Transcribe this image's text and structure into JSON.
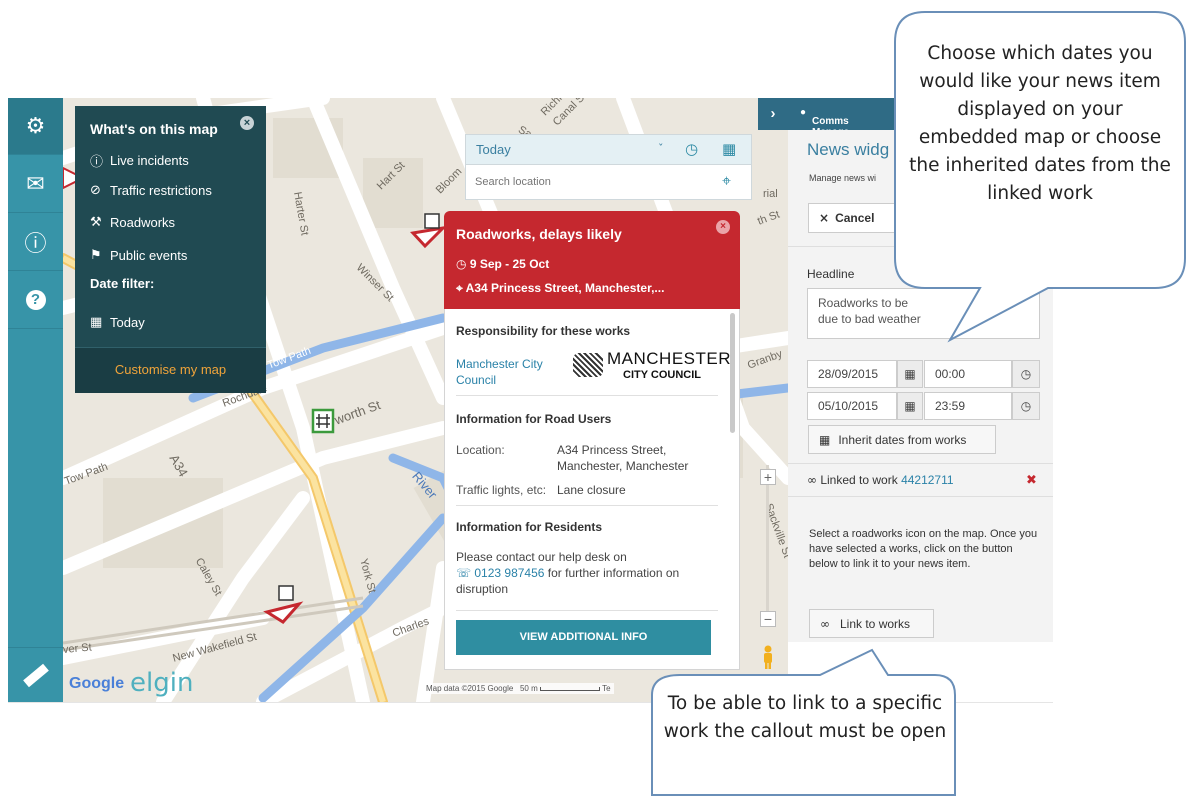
{
  "sidebar": {
    "buttons": [
      {
        "icon": "map-pin-icon"
      },
      {
        "icon": "envelope-icon"
      },
      {
        "icon": "info-icon"
      },
      {
        "icon": "help-icon"
      },
      {
        "icon": "ruler-icon"
      }
    ]
  },
  "whats_on": {
    "title": "What's on this map",
    "items": [
      {
        "label": "Live incidents",
        "icon": "alert-circle-icon"
      },
      {
        "label": "Traffic restrictions",
        "icon": "no-entry-icon"
      },
      {
        "label": "Roadworks",
        "icon": "roadworks-icon"
      },
      {
        "label": "Public events",
        "icon": "megaphone-icon"
      }
    ],
    "date_filter_label": "Date filter:",
    "date_filter_value": "Today",
    "customise": "Customise my map"
  },
  "date_box": {
    "selected": "Today",
    "search_placeholder": "Search location"
  },
  "callout": {
    "headline": "Roadworks, delays likely",
    "dates": "9 Sep - 25 Oct",
    "address": "A34 Princess Street, Manchester,...",
    "responsibility_heading": "Responsibility for these works",
    "authority": "Manchester City Council",
    "logo_line1": "MANCHESTER",
    "logo_line2": "CITY COUNCIL",
    "road_users_heading": "Information for Road Users",
    "location_label": "Location:",
    "location_value": "A34 Princess Street, Manchester, Manchester",
    "traffic_label": "Traffic lights, etc:",
    "traffic_value": "Lane closure",
    "residents_heading": "Information for Residents",
    "residents_text_1": "Please contact our help desk on",
    "phone": "0123 987456",
    "residents_text_2": "for further information on disruption",
    "button": "VIEW ADDITIONAL INFO"
  },
  "map": {
    "streets": [
      "Tow Path",
      "Rochdale",
      "A34",
      "Tow Path",
      "River",
      "York St",
      "Charles",
      "Harter St",
      "Hart St",
      "Bloom",
      "Canal St",
      "Richm",
      "Sac",
      "Winser St",
      "worth St",
      "Granby",
      "New Wakefield St",
      "ver St",
      "Caley St",
      "Sackville St",
      "rial",
      "th St"
    ],
    "attribution": "Map data ©2015 Google",
    "scale": "50 m",
    "terms": "Te",
    "google": "Google",
    "brand": "elgin"
  },
  "right_panel": {
    "user": "Comms Manage",
    "title": "News widg",
    "subtitle": "Manage news wi",
    "cancel": "Cancel",
    "headline_label": "Headline",
    "headline_value": "Roadworks to be\ndue to bad weather",
    "start_date": "28/09/2015",
    "start_time": "00:00",
    "end_date": "05/10/2015",
    "end_time": "23:59",
    "inherit_button": "Inherit dates from works",
    "linked_prefix": "Linked to work",
    "linked_id": "44212711",
    "help_text": "Select a roadworks icon on the map. Once you have selected a works, click on the button below to link it to your news item.",
    "link_button": "Link to works"
  },
  "bubbles": {
    "top": "Choose which dates you would like your news item displayed on your embedded map or choose the inherited dates from the linked work",
    "bottom": "To be able to link to a specific work the callout must be open"
  },
  "colors": {
    "rail": "#3794a8",
    "panel_dark": "#204a52",
    "callout_red": "#c5282f",
    "accent_blue": "#2a82a8",
    "bubble_border": "#6a8fb8"
  }
}
